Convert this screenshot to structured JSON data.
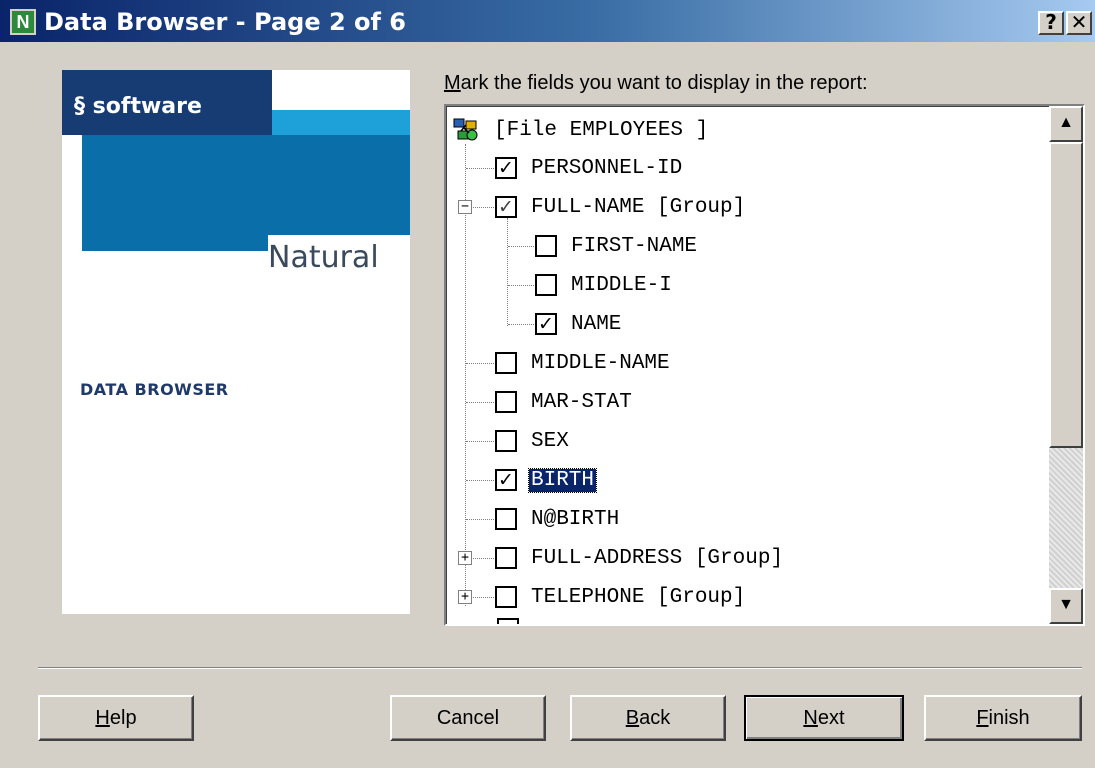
{
  "window": {
    "title": "Data Browser - Page 2 of 6",
    "app_icon_letter": "N",
    "help_glyph": "?",
    "close_glyph": "✕"
  },
  "logo": {
    "software_text": "software",
    "product_text": "Natural",
    "panel_caption": "DATA BROWSER"
  },
  "instruction": {
    "mnemonic": "M",
    "rest": "ark the fields you want to display in the report:"
  },
  "tree": {
    "root_label": "[File EMPLOYEES ]",
    "items": [
      {
        "label": "PERSONNEL-ID",
        "checked": "✓"
      },
      {
        "label": "FULL-NAME [Group]",
        "checked": "✓",
        "expander": "−"
      },
      {
        "label": "FIRST-NAME",
        "checked": ""
      },
      {
        "label": "MIDDLE-I",
        "checked": ""
      },
      {
        "label": "NAME",
        "checked": "✓"
      },
      {
        "label": "MIDDLE-NAME",
        "checked": ""
      },
      {
        "label": "MAR-STAT",
        "checked": ""
      },
      {
        "label": "SEX",
        "checked": ""
      },
      {
        "label": "BIRTH",
        "checked": "✓"
      },
      {
        "label": "N@BIRTH",
        "checked": ""
      },
      {
        "label": "FULL-ADDRESS [Group]",
        "checked": "",
        "expander": "+"
      },
      {
        "label": "TELEPHONE [Group]",
        "checked": "",
        "expander": "+"
      }
    ],
    "scroll_up": "▲",
    "scroll_down": "▼"
  },
  "buttons": {
    "help": {
      "mnemonic": "H",
      "rest": "elp"
    },
    "cancel": "Cancel",
    "back": {
      "mnemonic": "B",
      "rest": "ack"
    },
    "next": {
      "mnemonic": "N",
      "rest": "ext"
    },
    "finish": {
      "mnemonic": "F",
      "rest": "inish"
    }
  }
}
